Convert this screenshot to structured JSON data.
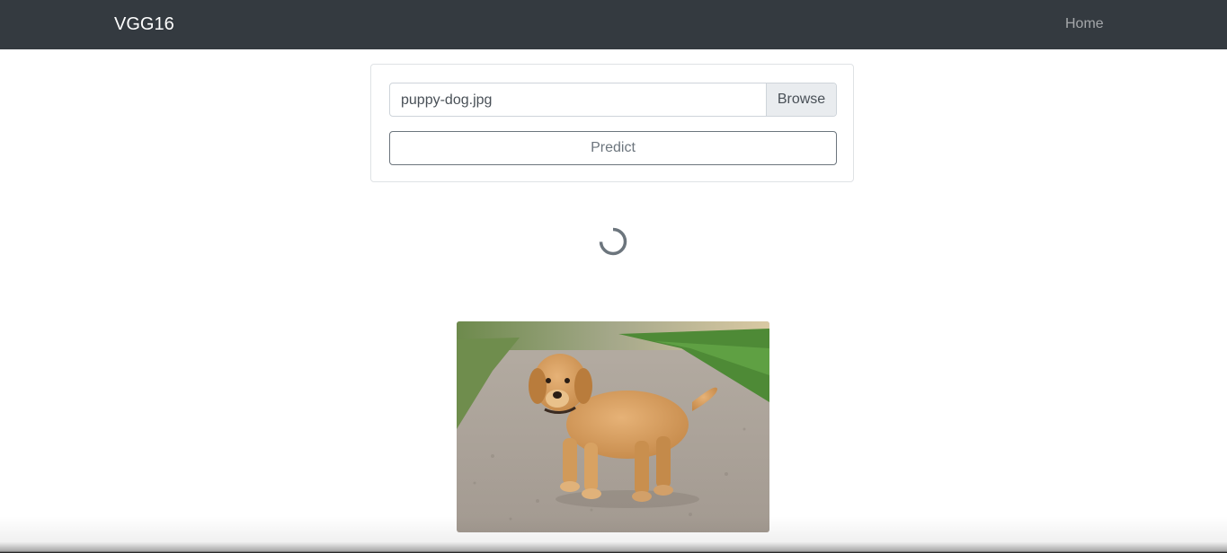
{
  "navbar": {
    "brand": "VGG16",
    "home_label": "Home",
    "background": "#343a40"
  },
  "upload_form": {
    "file_name": "puppy-dog.jpg",
    "browse_label": "Browse",
    "predict_label": "Predict"
  },
  "loading": {
    "icon": "spinner-icon",
    "active": true
  },
  "preview": {
    "subject": "golden-retriever-puppy-photo"
  }
}
